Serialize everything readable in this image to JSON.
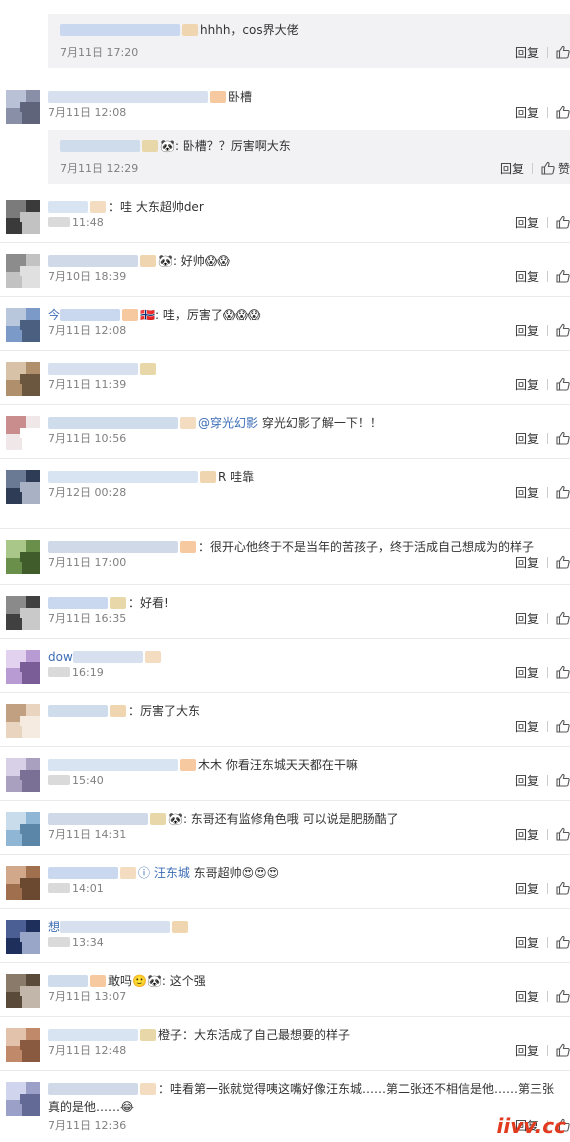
{
  "reply_label": "回复",
  "like_label": "赞",
  "watermark": "iivv.cc",
  "colors": {
    "mention": "#3b6cb5",
    "timestamp": "#808080",
    "nested_bg": "#f2f2f5",
    "watermark": "#e23a1f"
  },
  "comments": [
    {
      "kind": "nested",
      "pre": "",
      "text": "hhhh，cos界大佬",
      "time": "7月11日 17:20",
      "like_count": ""
    },
    {
      "kind": "top",
      "pre": "",
      "text": "卧槽",
      "time": "7月11日 12:08",
      "like_count": ""
    },
    {
      "kind": "nested",
      "pre": "",
      "text": "🐼: 卧槽？？厉害啊大东",
      "time": "7月11日 12:29",
      "like_count": "赞"
    },
    {
      "kind": "top",
      "pre": "",
      "text": "：哇 大东超帅der",
      "time": "11:48",
      "like_count": ""
    },
    {
      "kind": "top",
      "pre": "",
      "text": "🐼: 好帅😱😱",
      "time": "7月10日 18:39",
      "like_count": ""
    },
    {
      "kind": "top",
      "pre": "今",
      "text": "🇳🇴: 哇，厉害了😱😱😱",
      "time": "7月11日 12:08",
      "like_count": ""
    },
    {
      "kind": "top",
      "pre": "",
      "text": "",
      "time": "7月11日 11:39",
      "like_count": ""
    },
    {
      "kind": "top",
      "pre": "",
      "text": "",
      "mention": "@穿光幻影",
      "tail": " 穿光幻影了解一下！！",
      "time": "7月11日 10:56",
      "like_count": ""
    },
    {
      "kind": "top",
      "pre": "",
      "text": "R 哇靠",
      "time": "7月12日 00:28",
      "like_count": ""
    },
    {
      "kind": "top",
      "pre": "",
      "text": "：很开心他终于不是当年的苦孩子，终于活成自己想成为的样子",
      "time": "7月11日 17:00",
      "like_count": ""
    },
    {
      "kind": "top",
      "pre": "",
      "text": "：好看!",
      "time": "7月11日 16:35",
      "like_count": ""
    },
    {
      "kind": "top",
      "pre": "dow",
      "text": "",
      "time": "16:19",
      "like_count": ""
    },
    {
      "kind": "top",
      "pre": "",
      "text": "：厉害了大东",
      "time": "",
      "like_count": ""
    },
    {
      "kind": "top",
      "pre": "",
      "text": "木木 你看汪东城天天都在干嘛",
      "time": "15:40",
      "like_count": ""
    },
    {
      "kind": "top",
      "pre": "",
      "text": "🐼: 东哥还有监修角色哦 可以说是肥肠酷了",
      "time": "7月11日 14:31",
      "like_count": ""
    },
    {
      "kind": "top",
      "pre": "",
      "text": "",
      "mention": "ⓘ 汪东城",
      "tail": " 东哥超帅😍😍😍",
      "time": "14:01",
      "like_count": ""
    },
    {
      "kind": "top",
      "pre": "想",
      "text": "",
      "time": "13:34",
      "like_count": ""
    },
    {
      "kind": "top",
      "pre": "",
      "text": "敢吗🙂🐼: 这个强",
      "time": "7月11日 13:07",
      "like_count": ""
    },
    {
      "kind": "top",
      "pre": "",
      "text": "橙子：大东活成了自己最想要的样子",
      "time": "7月11日 12:48",
      "like_count": ""
    },
    {
      "kind": "top",
      "pre": "",
      "text": "：哇看第一张就觉得咦这嘴好像汪东城……第二张还不相信是他……第三张真的是他……😂",
      "time": "7月11日 12:36",
      "like_count": ""
    }
  ]
}
